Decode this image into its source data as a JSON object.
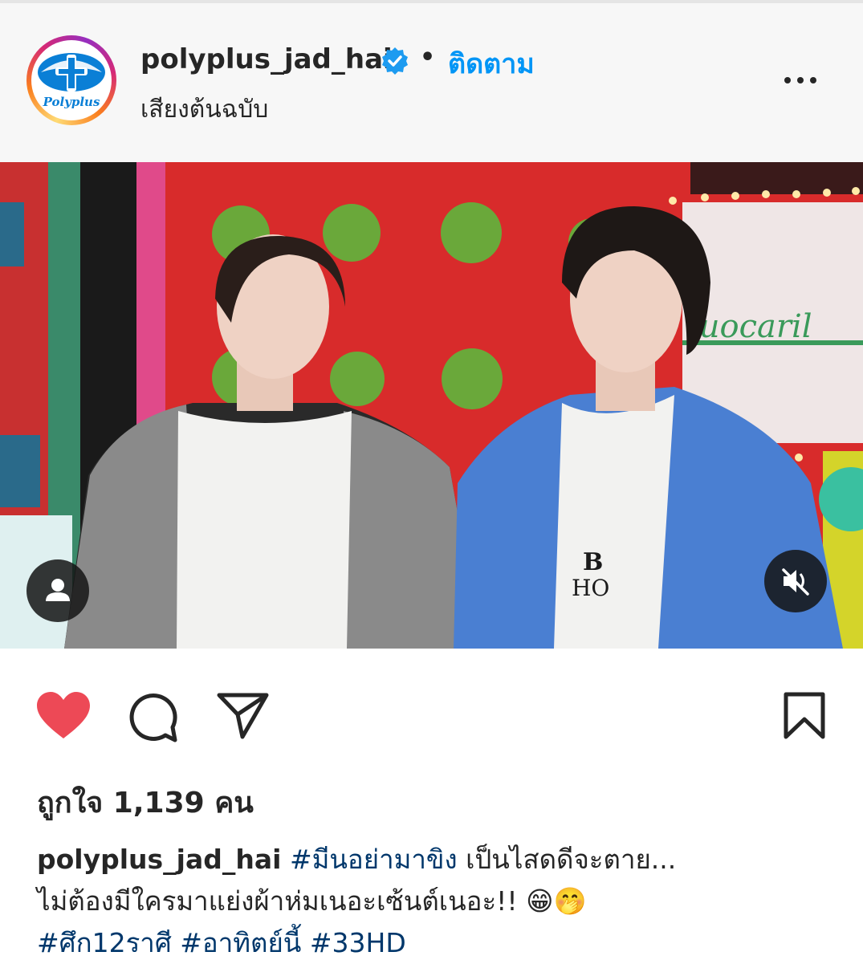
{
  "post": {
    "username": "polyplus_jad_hai",
    "separator": "•",
    "follow_label": "ติดตาม",
    "audio_label": "เสียงต้นฉบับ",
    "avatar_logo_text": "Polyplus"
  },
  "media": {
    "sign_text": "luocaril"
  },
  "actions": {
    "like_icon": "heart-filled-icon",
    "comment_icon": "comment-icon",
    "share_icon": "send-icon",
    "save_icon": "bookmark-icon",
    "like_color": "#ed4956"
  },
  "likes": {
    "text": "ถูกใจ 1,139 คน"
  },
  "caption": {
    "username": "polyplus_jad_hai",
    "hashtag1": "#มีนอย่ามาขิง",
    "line1_text": " เป็นไสดดีจะตาย...",
    "line2_text": "ไม่ต้องมีใครมาแย่งผ้าห่มเนอะเซ้นต์เนอะ!! 😁🤭",
    "hashtag2": "#ศึก12ราศี",
    "hashtag3": "#อาทิตย์นี้",
    "hashtag4": "#33HD"
  },
  "colors": {
    "link": "#0095f6",
    "hashtag": "#00376b",
    "header_bg": "#f7f7f7"
  }
}
